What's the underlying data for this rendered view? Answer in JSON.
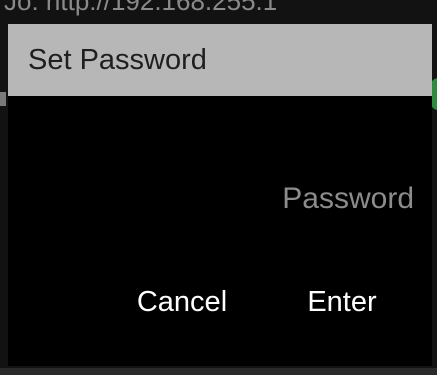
{
  "background": {
    "partial_text": "Jo:    http://192.168.255.1"
  },
  "dialog": {
    "title": "Set Password",
    "password_placeholder": "Password",
    "cancel_label": "Cancel",
    "enter_label": "Enter"
  },
  "colors": {
    "title_bar": "#b7b7b7",
    "dialog_body": "#000000",
    "placeholder": "#8c8c8c",
    "button_text": "#ffffff"
  }
}
